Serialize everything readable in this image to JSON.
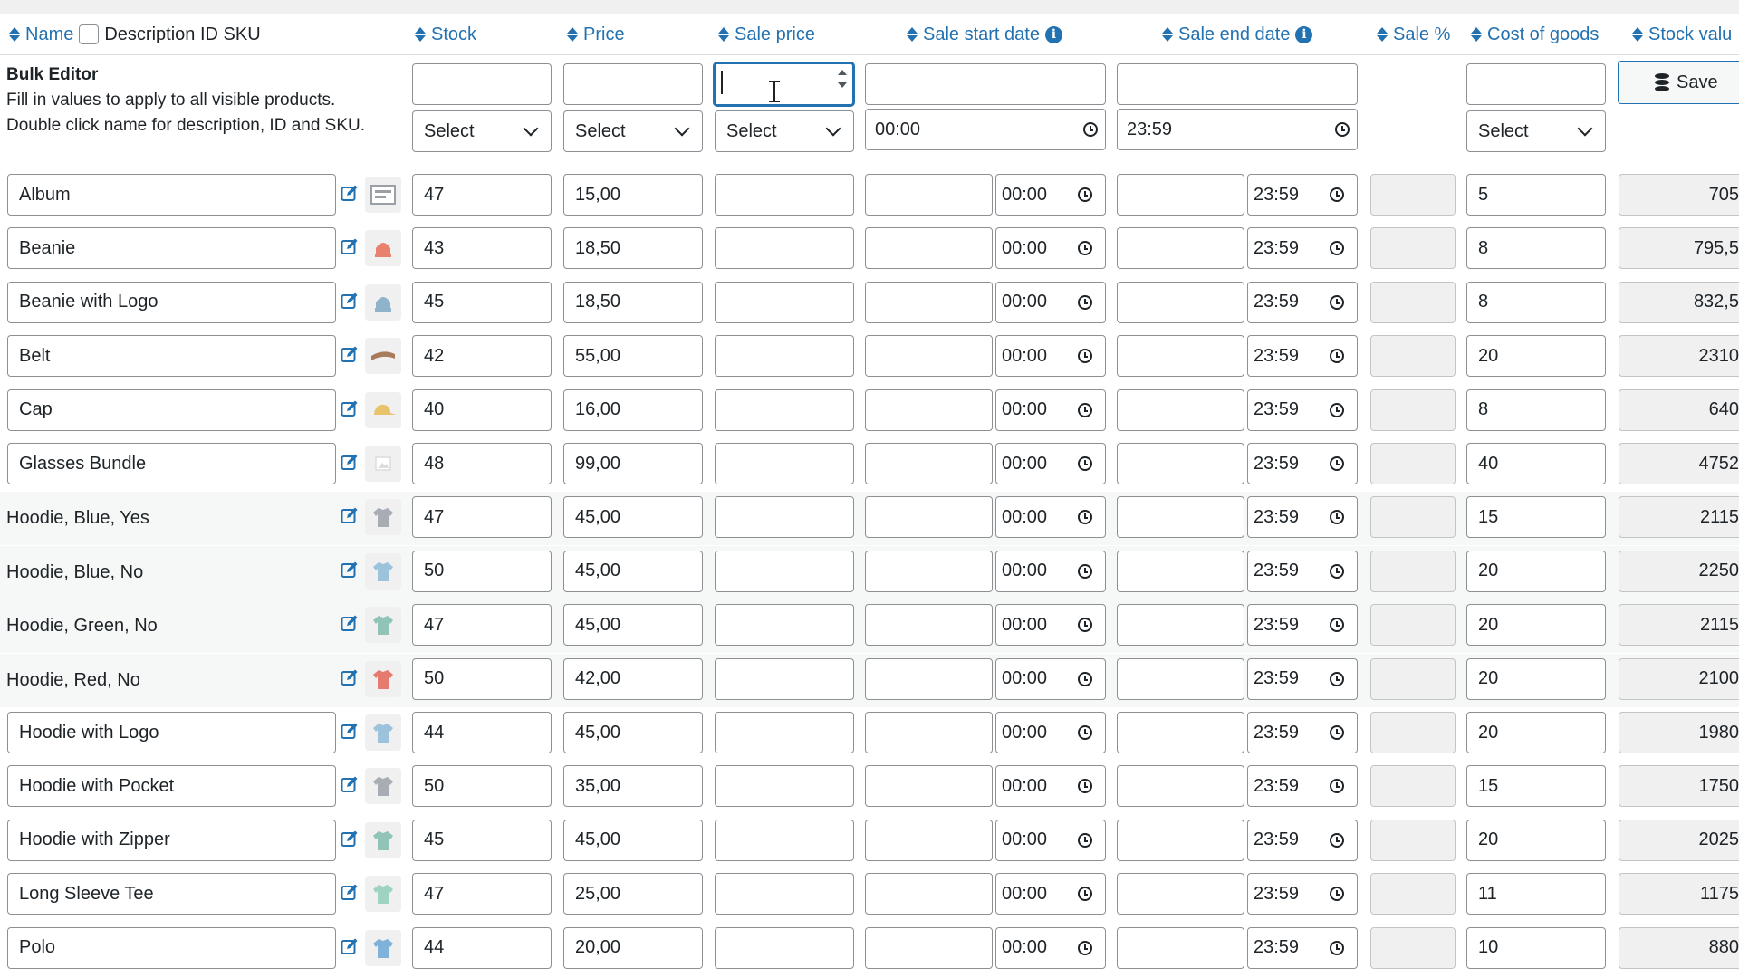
{
  "header": {
    "name": "Name",
    "description_id_sku": "Description ID SKU",
    "stock": "Stock",
    "price": "Price",
    "sale_price": "Sale price",
    "sale_start_date": "Sale start date",
    "sale_end_date": "Sale end date",
    "sale_pct": "Sale %",
    "cost_of_goods": "Cost of goods",
    "stock_value": "Stock valu"
  },
  "bulk": {
    "title": "Bulk Editor",
    "description": "Fill in values to apply to all visible products. Double click name for description, ID and SKU.",
    "stock_mode": "Select",
    "price_mode": "Select",
    "sale_price_mode": "Select",
    "cost_mode": "Select",
    "start_time": "00:00",
    "end_time": "23:59",
    "save_label": "Save"
  },
  "rows": [
    {
      "name": "Album",
      "stock": "47",
      "price": "15,00",
      "start_time": "00:00",
      "end_time": "23:59",
      "cost": "5",
      "stock_value": "705",
      "thumb": "album",
      "name_editable": true
    },
    {
      "name": "Beanie",
      "stock": "43",
      "price": "18,50",
      "start_time": "00:00",
      "end_time": "23:59",
      "cost": "8",
      "stock_value": "795,5",
      "thumb": "beanie",
      "name_editable": true
    },
    {
      "name": "Beanie with Logo",
      "stock": "45",
      "price": "18,50",
      "start_time": "00:00",
      "end_time": "23:59",
      "cost": "8",
      "stock_value": "832,5",
      "thumb": "beanie-logo",
      "name_editable": true
    },
    {
      "name": "Belt",
      "stock": "42",
      "price": "55,00",
      "start_time": "00:00",
      "end_time": "23:59",
      "cost": "20",
      "stock_value": "2310",
      "thumb": "belt",
      "name_editable": true
    },
    {
      "name": "Cap",
      "stock": "40",
      "price": "16,00",
      "start_time": "00:00",
      "end_time": "23:59",
      "cost": "8",
      "stock_value": "640",
      "thumb": "cap",
      "name_editable": true
    },
    {
      "name": "Glasses Bundle",
      "stock": "48",
      "price": "99,00",
      "start_time": "00:00",
      "end_time": "23:59",
      "cost": "40",
      "stock_value": "4752",
      "thumb": "placeholder",
      "name_editable": true
    },
    {
      "name": "Hoodie, Blue, Yes",
      "stock": "47",
      "price": "45,00",
      "start_time": "00:00",
      "end_time": "23:59",
      "cost": "15",
      "stock_value": "2115",
      "thumb": "hoodie-grey",
      "name_editable": false
    },
    {
      "name": "Hoodie, Blue, No",
      "stock": "50",
      "price": "45,00",
      "start_time": "00:00",
      "end_time": "23:59",
      "cost": "20",
      "stock_value": "2250",
      "thumb": "hoodie-blue",
      "name_editable": false
    },
    {
      "name": "Hoodie, Green, No",
      "stock": "47",
      "price": "45,00",
      "start_time": "00:00",
      "end_time": "23:59",
      "cost": "20",
      "stock_value": "2115",
      "thumb": "hoodie-green",
      "name_editable": false
    },
    {
      "name": "Hoodie, Red, No",
      "stock": "50",
      "price": "42,00",
      "start_time": "00:00",
      "end_time": "23:59",
      "cost": "20",
      "stock_value": "2100",
      "thumb": "hoodie-red",
      "name_editable": false
    },
    {
      "name": "Hoodie with Logo",
      "stock": "44",
      "price": "45,00",
      "start_time": "00:00",
      "end_time": "23:59",
      "cost": "20",
      "stock_value": "1980",
      "thumb": "hoodie-blue",
      "name_editable": true
    },
    {
      "name": "Hoodie with Pocket",
      "stock": "50",
      "price": "35,00",
      "start_time": "00:00",
      "end_time": "23:59",
      "cost": "15",
      "stock_value": "1750",
      "thumb": "hoodie-grey",
      "name_editable": true
    },
    {
      "name": "Hoodie with Zipper",
      "stock": "45",
      "price": "45,00",
      "start_time": "00:00",
      "end_time": "23:59",
      "cost": "20",
      "stock_value": "2025",
      "thumb": "hoodie-green",
      "name_editable": true
    },
    {
      "name": "Long Sleeve Tee",
      "stock": "47",
      "price": "25,00",
      "start_time": "00:00",
      "end_time": "23:59",
      "cost": "11",
      "stock_value": "1175",
      "thumb": "tee-green",
      "name_editable": true
    },
    {
      "name": "Polo",
      "stock": "44",
      "price": "20,00",
      "start_time": "00:00",
      "end_time": "23:59",
      "cost": "10",
      "stock_value": "880",
      "thumb": "polo-blue",
      "name_editable": true
    }
  ],
  "colors": {
    "accent": "#2271b1",
    "thumb_album": "#9aa0a6",
    "thumb_beanie": "#e8826f",
    "thumb_beanie_logo": "#8fb3c9",
    "thumb_belt": "#a87b5a",
    "thumb_cap": "#e7c46a",
    "thumb_placeholder": "#dcdcde",
    "thumb_hoodie_grey": "#a7adb3",
    "thumb_hoodie_blue": "#9cc3db",
    "thumb_hoodie_green": "#8fc4b7",
    "thumb_hoodie_red": "#e57a6e",
    "thumb_tee_green": "#9fd3c1",
    "thumb_polo_blue": "#7fb2d8"
  }
}
